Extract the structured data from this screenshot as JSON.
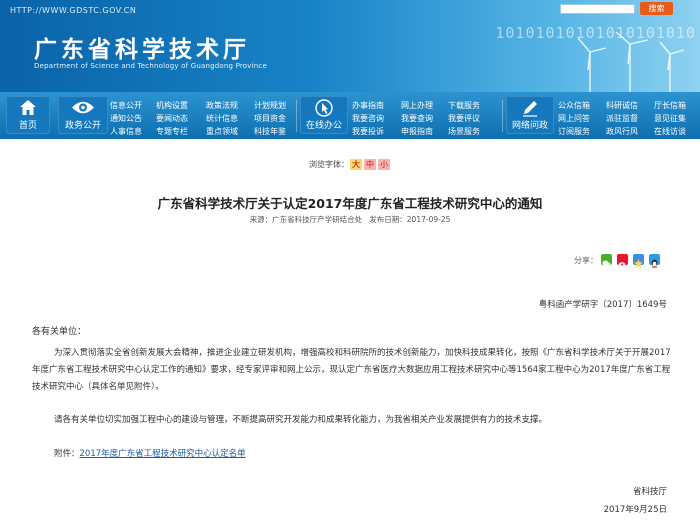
{
  "header": {
    "url": "HTTP://WWW.GDSTC.GOV.CN",
    "title": "广东省科学技术厅",
    "subtitle": "Department of Science and Technology of Guangdong Province",
    "binary": "10101010101010101010",
    "search_button": "搜索",
    "colors": {
      "banner": "#1883c7",
      "nav": "#0d6fb1",
      "search": "#e85b1a"
    }
  },
  "nav": {
    "home": {
      "label": "首页",
      "icon": "home-icon"
    },
    "gov": {
      "label": "政务公开",
      "icon": "eye-icon",
      "links": [
        [
          "信息公开",
          "机构设置",
          "政策法规",
          "计划规划"
        ],
        [
          "通知公告",
          "要闻动态",
          "统计信息",
          "项目资金"
        ],
        [
          "人事信息",
          "专题专栏",
          "重点领域",
          "科技年鉴"
        ]
      ]
    },
    "online": {
      "label": "在线办公",
      "icon": "pointer-icon",
      "links": [
        [
          "办事指南",
          "网上办理",
          "下载服务"
        ],
        [
          "我要咨询",
          "我要查询",
          "我要评议"
        ],
        [
          "我要投诉",
          "申报指南",
          "场景服务"
        ]
      ]
    },
    "interact": {
      "label": "网络问政",
      "icon": "pen-icon",
      "links": [
        [
          "公众信箱",
          "科研诚信",
          "厅长信箱"
        ],
        [
          "网上问答",
          "派驻监督",
          "意见征集"
        ],
        [
          "订阅服务",
          "政风行风",
          "在线访谈"
        ]
      ]
    }
  },
  "font_size": {
    "label": "浏览字体：",
    "large": "大",
    "medium": "中",
    "small": "小"
  },
  "article": {
    "title": "广东省科学技术厅关于认定2017年度广东省工程技术研究中心的通知",
    "source_label": "来源：",
    "source": "广东省科技厅产学研结合处",
    "date_label": "发布日期：",
    "date": "2017-09-25",
    "share_label": "分享：",
    "doc_number": "粤科函产学研字〔2017〕1649号",
    "recipient": "各有关单位：",
    "paragraphs": [
      "为深入贯彻落实全省创新发展大会精神，推进企业建立研发机构，增强高校和科研院所的技术创新能力，加快科技成果转化，按照《广东省科学技术厅关于开展2017年度广东省工程技术研究中心认定工作的通知》要求，经专家评审和网上公示，现认定广东省医疗大数据应用工程技术研究中心等1564家工程中心为2017年度广东省工程技术研究中心（具体名单见附件）。",
      "请各有关单位切实加强工程中心的建设与管理，不断提高研究开发能力和成果转化能力，为我省相关产业发展提供有力的技术支撑。"
    ],
    "attachment_label": "附件：",
    "attachment_link": "2017年度广东省工程技术研究中心认定名单",
    "signer": "省科技厅",
    "sign_date": "2017年9月25日"
  }
}
